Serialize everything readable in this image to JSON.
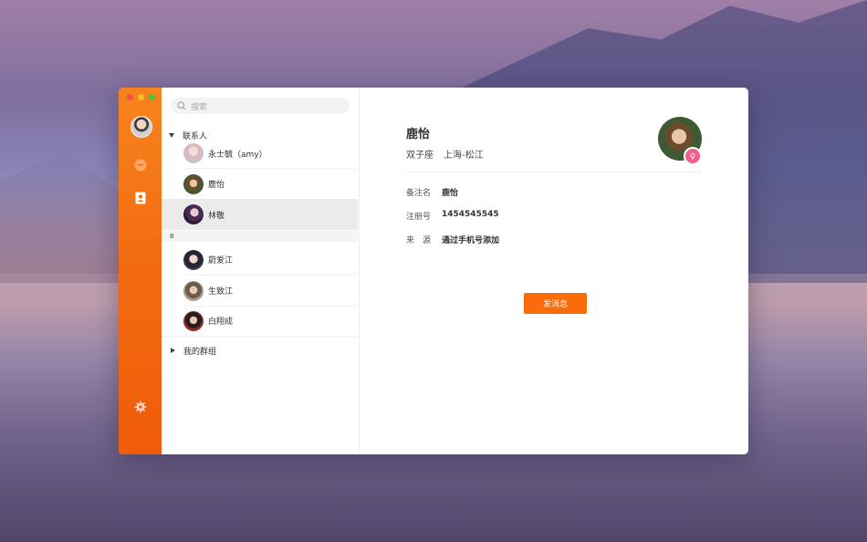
{
  "search": {
    "placeholder": "搜索"
  },
  "groups": {
    "contacts_label": "联系人",
    "my_groups_label": "我的群组"
  },
  "contacts_a": [
    {
      "name": "永士毓（amy）"
    },
    {
      "name": "鹿怡"
    },
    {
      "name": "林敬",
      "active": true
    }
  ],
  "letter_b": "B",
  "contacts_b": [
    {
      "name": "蔚爱江"
    },
    {
      "name": "生致江"
    },
    {
      "name": "白翔成"
    }
  ],
  "detail": {
    "name": "鹿怡",
    "zodiac": "双子座",
    "location": "上海-松江",
    "fields": [
      {
        "label": "备注名",
        "value": "鹿怡"
      },
      {
        "label": "注册号",
        "value": "1454545545"
      },
      {
        "label": "来　源",
        "value": "通过手机号添加"
      }
    ],
    "send_button": "发消息"
  },
  "colors": {
    "accent": "#fb6b0a",
    "rail_top": "#f7841e",
    "rail_bottom": "#f05c0b",
    "badge": "#f25f8a"
  },
  "icons": [
    "chat-icon",
    "contacts-icon",
    "settings-icon",
    "search-icon"
  ]
}
